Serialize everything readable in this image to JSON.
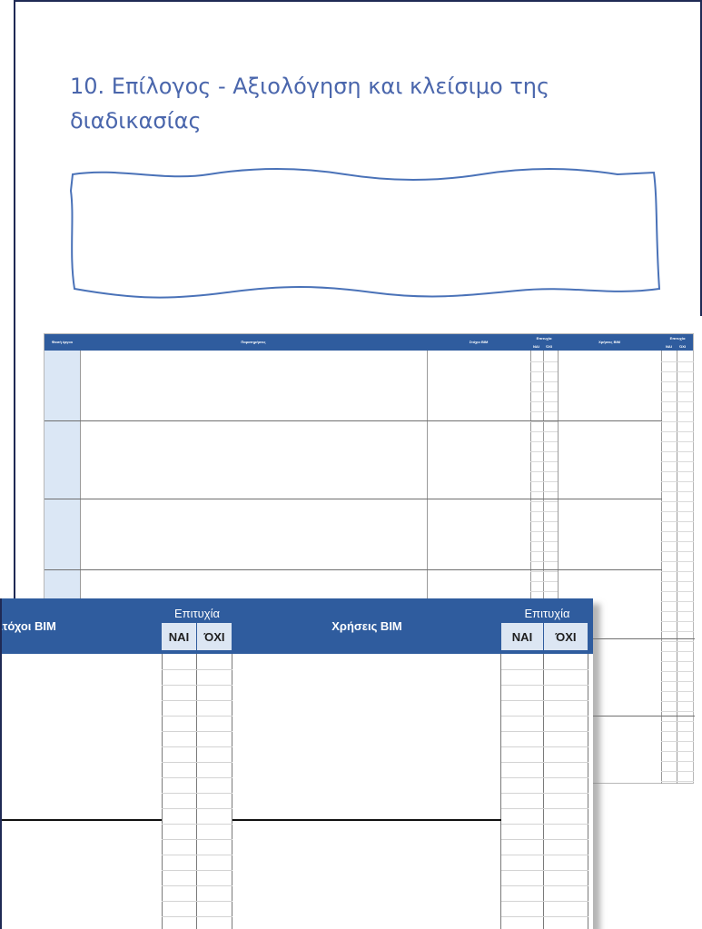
{
  "slide": {
    "title": "10. Επίλογος - Αξιολόγηση και κλείσιμο της διαδικασίας",
    "accent_color": "#4a66ac",
    "frame_color": "#1f2a55"
  },
  "small_table": {
    "columns": [
      "Φασή έργου",
      "Παρατηρήσεις",
      "Στόχοι BIM",
      "Επιτυχία",
      "Χρήσεις BIM",
      "Επιτυχία"
    ],
    "success_sub": [
      "ΝΑΙ",
      "ΌΧΙ"
    ],
    "header_color": "#2f5c9e"
  },
  "large_table": {
    "goals_header": "Στόχοι BIM",
    "success_header": "Επιτυχία",
    "uses_header": "Χρήσεις BIM",
    "yes_label": "ΝΑΙ",
    "no_label": "ΌΧΙ",
    "header_color": "#2f5c9e",
    "subheader_color": "#dce6f3"
  }
}
